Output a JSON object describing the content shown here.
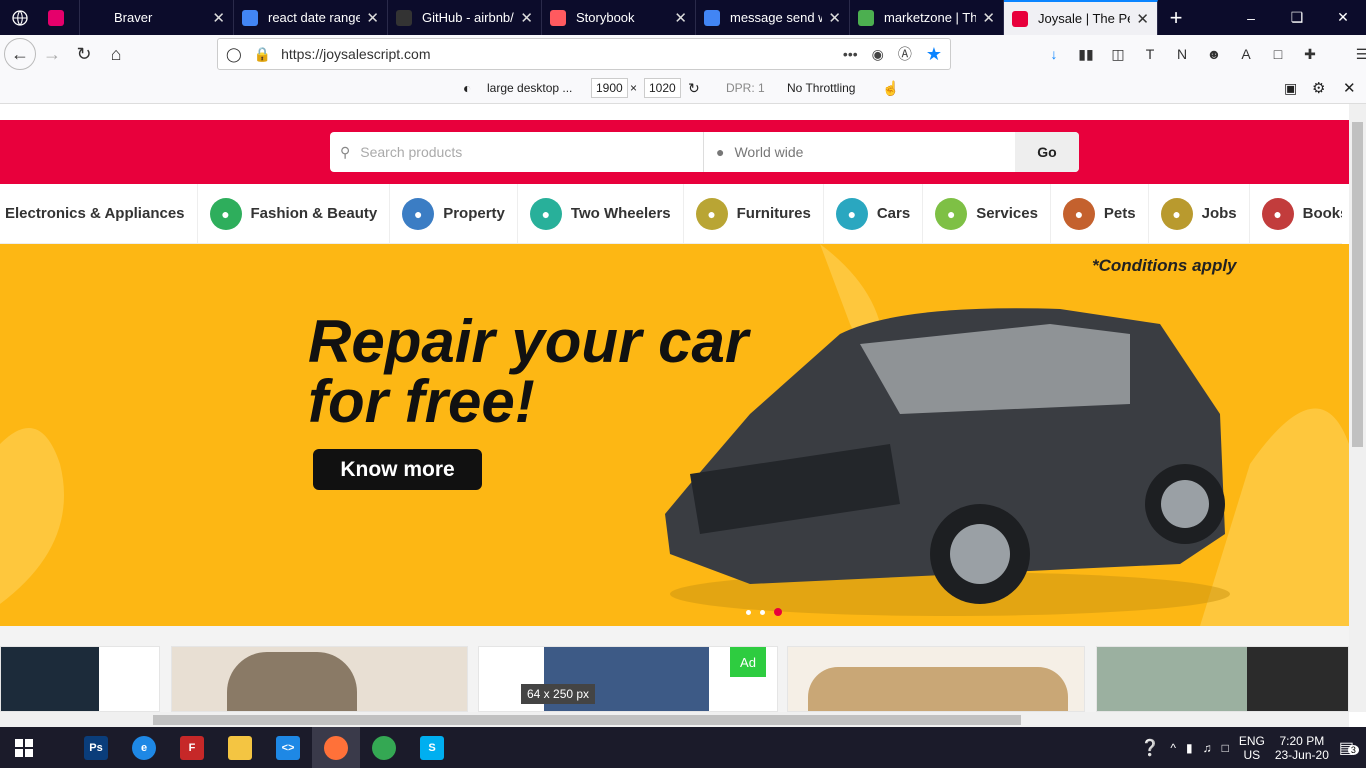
{
  "browser": {
    "tabs": [
      {
        "title": "",
        "icon": "invision-icon",
        "color": "#e5006b"
      },
      {
        "title": "Braver",
        "icon": "blank-icon",
        "color": "#0c0c2b"
      },
      {
        "title": "react date range p",
        "icon": "google-icon",
        "color": "#4285f4"
      },
      {
        "title": "GitHub - airbnb/r",
        "icon": "github-icon",
        "color": "#333"
      },
      {
        "title": "Storybook",
        "icon": "airbnb-icon",
        "color": "#ff5a5f"
      },
      {
        "title": "message send wit",
        "icon": "google-icon",
        "color": "#4285f4"
      },
      {
        "title": "marketzone | The",
        "icon": "marketzone-icon",
        "color": "#4caf50"
      },
      {
        "title": "Joysale | The Perfe",
        "icon": "joysale-icon",
        "color": "#e8003c"
      }
    ],
    "url": "https://joysalescript.com",
    "device": "large desktop ...",
    "width": "1900",
    "height": "1020",
    "dpr": "DPR: 1",
    "throttling": "No Throttling"
  },
  "site": {
    "search_placeholder": "Search products",
    "location": "World wide",
    "go_label": "Go",
    "categories": [
      {
        "label": "Electronics & Appliances",
        "color": "#ffffff"
      },
      {
        "label": "Fashion & Beauty",
        "color": "#2eae5c"
      },
      {
        "label": "Property",
        "color": "#3b7dc4"
      },
      {
        "label": "Two Wheelers",
        "color": "#28b09a"
      },
      {
        "label": "Furnitures",
        "color": "#b9a534"
      },
      {
        "label": "Cars",
        "color": "#2aa7c0"
      },
      {
        "label": "Services",
        "color": "#7ec045"
      },
      {
        "label": "Pets",
        "color": "#c4612e"
      },
      {
        "label": "Jobs",
        "color": "#b99a2e"
      },
      {
        "label": "Books & Hol",
        "color": "#c23c3c"
      }
    ],
    "banner": {
      "headline_1": "Repair your car",
      "headline_2": "for free!",
      "conditions": "*Conditions apply",
      "cta": "Know more",
      "slides": 3,
      "active_slide": 3
    },
    "ad_badge": "Ad",
    "tooltip": "64 x 250 px"
  },
  "taskbar": {
    "apps": [
      {
        "name": "photoshop-icon",
        "label": "Ps",
        "color": "#0a3d7a"
      },
      {
        "name": "edge-icon",
        "label": "e",
        "color": "#1e88e5"
      },
      {
        "name": "filezilla-icon",
        "label": "F",
        "color": "#c62828"
      },
      {
        "name": "file-explorer-icon",
        "label": "",
        "color": "#f4c542"
      },
      {
        "name": "vscode-icon",
        "label": "<>",
        "color": "#1e88e5"
      },
      {
        "name": "firefox-icon",
        "label": "",
        "color": "#ff7139"
      },
      {
        "name": "chrome-icon",
        "label": "",
        "color": "#34a853"
      },
      {
        "name": "skype-icon",
        "label": "S",
        "color": "#00aff0"
      }
    ],
    "lang": "ENG",
    "region": "US",
    "time": "7:20 PM",
    "date": "23-Jun-20",
    "notifications": "3"
  }
}
